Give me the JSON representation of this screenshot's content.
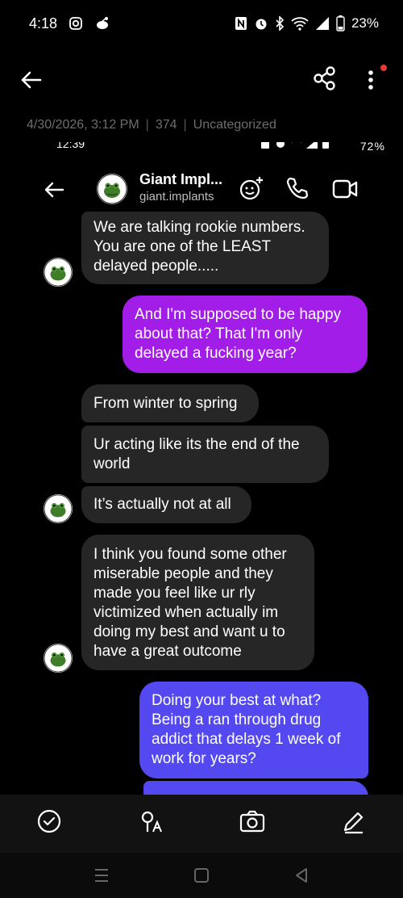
{
  "status_bar": {
    "time": "4:18",
    "battery": "23%"
  },
  "icons": {
    "back": "arrow-left-icon",
    "share": "share-icon",
    "more": "more-vertical-icon",
    "select": "check-circle-icon",
    "text_recognition": "text-recognition-icon",
    "camera": "camera-icon",
    "edit": "pencil-icon"
  },
  "meta": {
    "date": "4/30/2026, 3:12 PM",
    "count": "374",
    "category": "Uncategorized"
  },
  "screenshot": {
    "status_time": "12:39",
    "status_battery": "72%",
    "chat_header": {
      "name": "Giant Impl...",
      "username": "giant.implants"
    },
    "messages": [
      {
        "id": "m1",
        "direction": "received",
        "text": "We are talking rookie numbers. You are one of the LEAST delayed people....."
      },
      {
        "id": "m2",
        "direction": "sent",
        "text": "And I'm supposed to be happy about that? That I'm only delayed a fucking year?"
      },
      {
        "id": "m3",
        "direction": "received",
        "text": "From winter to spring"
      },
      {
        "id": "m4",
        "direction": "received",
        "text": "Ur acting like its the end of the world"
      },
      {
        "id": "m5",
        "direction": "received",
        "text": "It’s actually not at all"
      },
      {
        "id": "m6",
        "direction": "received",
        "text": "I think you found some other miserable people and they made you feel like ur rly victimized when actually im doing my best and want u to have a great outcome"
      },
      {
        "id": "m7",
        "direction": "sent",
        "text": "Doing your best at what? Being a ran through drug addict that delays 1 week of work for years?"
      }
    ]
  },
  "colors": {
    "background": "#000000",
    "received_bubble": "#262626",
    "sent_bubble_purple": "#a31de8",
    "sent_bubble_indigo": "#5448f0",
    "meta_text": "#6d6d6d",
    "notification_dot": "#e53935"
  }
}
